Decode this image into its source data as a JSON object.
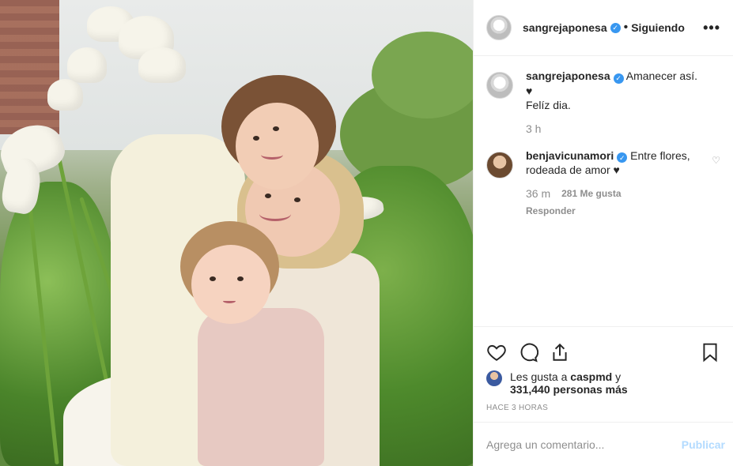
{
  "header": {
    "username": "sangrejaponesa",
    "separator": "•",
    "following_label": "Siguiendo",
    "more_label": "•••"
  },
  "caption": {
    "username": "sangrejaponesa",
    "text_line1": "Amanecer así.",
    "text_heart": "♥",
    "text_line2": "Felíz dia.",
    "time": "3 h"
  },
  "comments": [
    {
      "username": "benjavicunamori",
      "text": "Entre flores, rodeada de amor ♥",
      "time": "36 m",
      "likes": "281 Me gusta",
      "reply": "Responder"
    }
  ],
  "likes": {
    "prefix": "Les gusta a",
    "user": "caspmd",
    "middle": "y",
    "count": "331,440 personas más"
  },
  "timestamp": "HACE 3 HORAS",
  "add_comment": {
    "placeholder": "Agrega un comentario...",
    "publish_label": "Publicar"
  },
  "colors": {
    "verified": "#3897f0",
    "publish_disabled": "#b3dbff",
    "muted": "#8e8e8e"
  },
  "icons": [
    "heart-icon",
    "comment-icon",
    "share-icon",
    "bookmark-icon",
    "more-icon",
    "verified-badge-icon"
  ]
}
